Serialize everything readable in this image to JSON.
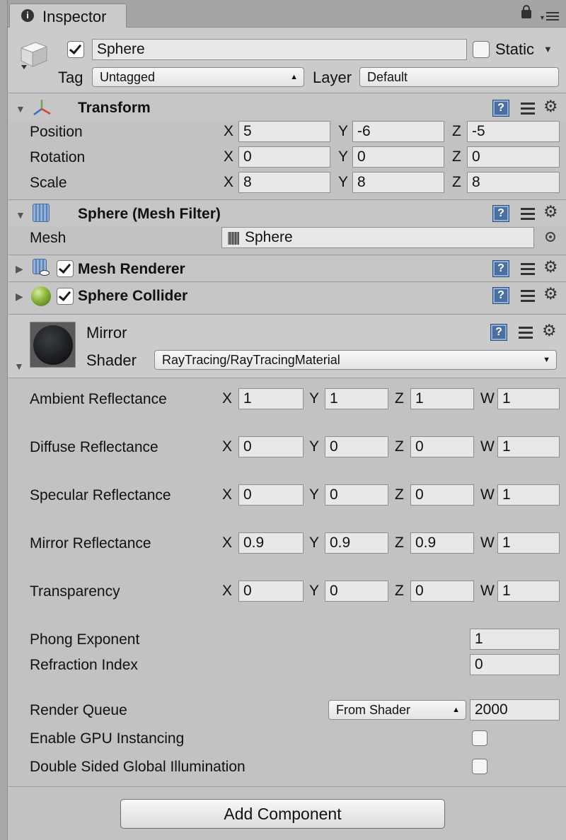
{
  "tab": {
    "title": "Inspector",
    "info_icon": "info-icon",
    "lock_icon": "lock-icon",
    "menu_icon": "menu-icon"
  },
  "gameobject": {
    "name": "Sphere",
    "active": true,
    "static_label": "Static",
    "static_checked": false,
    "tag_label": "Tag",
    "tag_value": "Untagged",
    "layer_label": "Layer",
    "layer_value": "Default"
  },
  "transform": {
    "title": "Transform",
    "rows": [
      {
        "label": "Position",
        "x": "5",
        "y": "-6",
        "z": "-5"
      },
      {
        "label": "Rotation",
        "x": "0",
        "y": "0",
        "z": "0"
      },
      {
        "label": "Scale",
        "x": "8",
        "y": "8",
        "z": "8"
      }
    ]
  },
  "axes": {
    "x": "X",
    "y": "Y",
    "z": "Z",
    "w": "W"
  },
  "mesh_filter": {
    "title": "Sphere (Mesh Filter)",
    "mesh_label": "Mesh",
    "mesh_value": "Sphere"
  },
  "mesh_renderer": {
    "title": "Mesh Renderer",
    "enabled": true
  },
  "sphere_collider": {
    "title": "Sphere Collider",
    "enabled": true
  },
  "material": {
    "name": "Mirror",
    "shader_label": "Shader",
    "shader_value": "RayTracing/RayTracingMaterial",
    "vectors": [
      {
        "label": "Ambient Reflectance",
        "x": "1",
        "y": "1",
        "z": "1",
        "w": "1"
      },
      {
        "label": "Diffuse Reflectance",
        "x": "0",
        "y": "0",
        "z": "0",
        "w": "1"
      },
      {
        "label": "Specular Reflectance",
        "x": "0",
        "y": "0",
        "z": "0",
        "w": "1"
      },
      {
        "label": "Mirror Reflectance",
        "x": "0.9",
        "y": "0.9",
        "z": "0.9",
        "w": "1"
      },
      {
        "label": "Transparency",
        "x": "0",
        "y": "0",
        "z": "0",
        "w": "1"
      }
    ],
    "phong_label": "Phong Exponent",
    "phong_value": "1",
    "refraction_label": "Refraction Index",
    "refraction_value": "0",
    "render_queue_label": "Render Queue",
    "render_queue_mode": "From Shader",
    "render_queue_value": "2000",
    "gpu_instancing_label": "Enable GPU Instancing",
    "gpu_instancing": false,
    "double_sided_label": "Double Sided Global Illumination",
    "double_sided": false
  },
  "add_component": "Add Component",
  "colors": {
    "background": "#c2c2c2",
    "header": "#cbcbcb",
    "help_icon": "#4b6fa0",
    "field": "#e8e8e8"
  }
}
